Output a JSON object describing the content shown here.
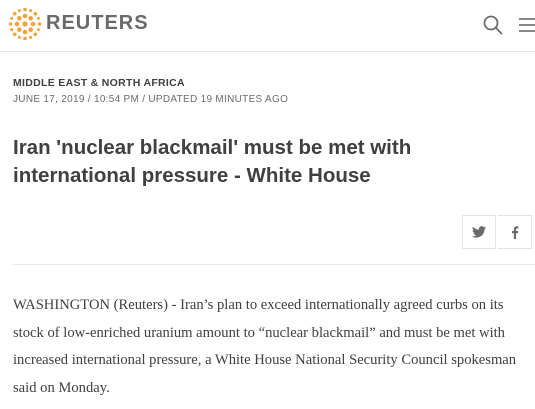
{
  "header": {
    "brand": "REUTERS",
    "icons": {
      "logo": "reuters-logo-icon",
      "search": "search-icon",
      "menu": "hamburger-menu-icon"
    },
    "colors": {
      "logo": "#f4a23c",
      "brand_text": "#6a6a6a"
    }
  },
  "article": {
    "section": "MIDDLE EAST & NORTH AFRICA",
    "dateline": "JUNE 17, 2019 / 10:54 PM / UPDATED 19 MINUTES AGO",
    "headline": "Iran 'nuclear blackmail' must be met with international pressure - White House",
    "share": {
      "twitter_icon": "twitter-icon",
      "facebook_icon": "facebook-icon"
    },
    "body": "WASHINGTON (Reuters) - Iran’s plan to exceed internationally agreed curbs on its stock of low-enriched uranium amount to “nuclear blackmail” and must be met with increased international pressure, a White House National Security Council spokesman said on Monday."
  }
}
